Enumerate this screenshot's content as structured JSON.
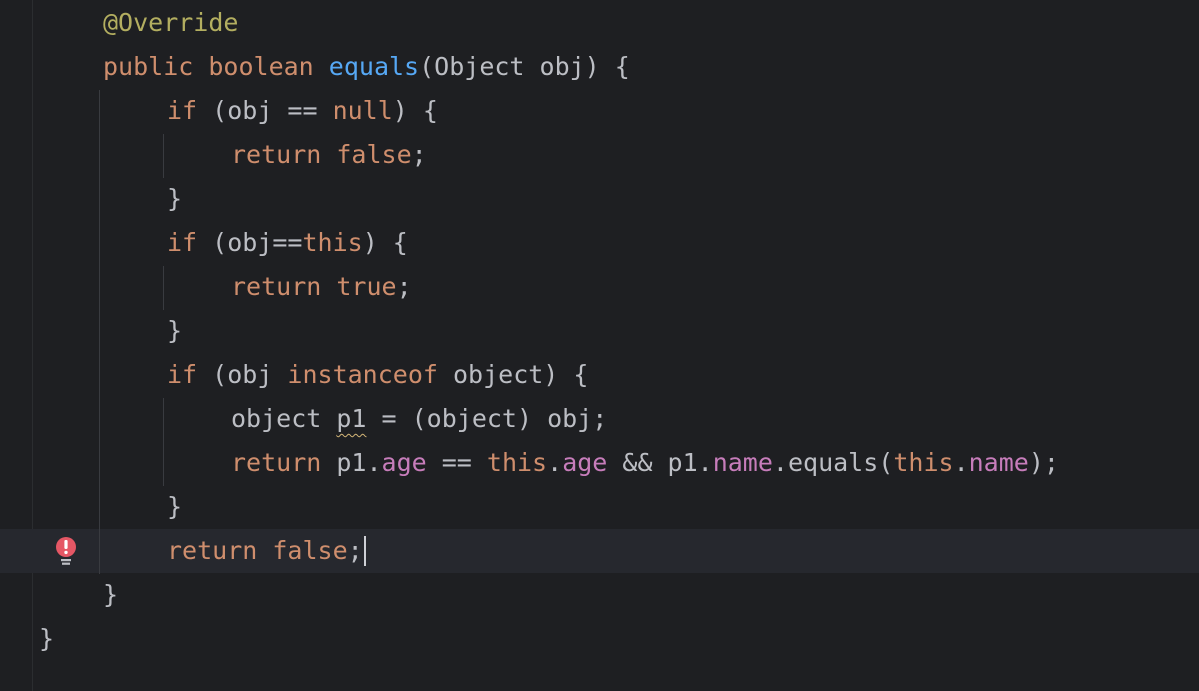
{
  "editor": {
    "language": "java",
    "colors": {
      "background": "#1e1f22",
      "current_line": "#26282e",
      "keyword": "#cf8e6d",
      "annotation": "#b3ae60",
      "method_declaration": "#56a8f5",
      "field": "#c77dbb",
      "default_text": "#bcbec4",
      "error_marker": "#e55765"
    },
    "gutter_icon": "error-lightbulb-icon",
    "lines": [
      {
        "indent": 1,
        "tokens": [
          {
            "t": "@Override",
            "c": "an"
          }
        ]
      },
      {
        "indent": 1,
        "tokens": [
          {
            "t": "public",
            "c": "kw"
          },
          {
            "t": " "
          },
          {
            "t": "boolean",
            "c": "kw"
          },
          {
            "t": " "
          },
          {
            "t": "equals",
            "c": "fn"
          },
          {
            "t": "(Object obj) {"
          }
        ]
      },
      {
        "indent": 2,
        "tokens": [
          {
            "t": "if",
            "c": "kw"
          },
          {
            "t": " (obj == "
          },
          {
            "t": "null",
            "c": "kw"
          },
          {
            "t": ") {"
          }
        ]
      },
      {
        "indent": 3,
        "tokens": [
          {
            "t": "return",
            "c": "kw"
          },
          {
            "t": " "
          },
          {
            "t": "false",
            "c": "kw"
          },
          {
            "t": ";"
          }
        ]
      },
      {
        "indent": 2,
        "tokens": [
          {
            "t": "}"
          }
        ]
      },
      {
        "indent": 2,
        "tokens": [
          {
            "t": "if",
            "c": "kw"
          },
          {
            "t": " (obj=="
          },
          {
            "t": "this",
            "c": "kw"
          },
          {
            "t": ") {"
          }
        ]
      },
      {
        "indent": 3,
        "tokens": [
          {
            "t": "return",
            "c": "kw"
          },
          {
            "t": " "
          },
          {
            "t": "true",
            "c": "kw"
          },
          {
            "t": ";"
          }
        ]
      },
      {
        "indent": 2,
        "tokens": [
          {
            "t": "}"
          }
        ]
      },
      {
        "indent": 2,
        "tokens": [
          {
            "t": "if",
            "c": "kw"
          },
          {
            "t": " (obj "
          },
          {
            "t": "instanceof",
            "c": "kw"
          },
          {
            "t": " object) {"
          }
        ]
      },
      {
        "indent": 3,
        "tokens": [
          {
            "t": "object "
          },
          {
            "t": "p1",
            "c": "tx",
            "warn": true
          },
          {
            "t": " = (object) obj;"
          }
        ]
      },
      {
        "indent": 3,
        "tokens": [
          {
            "t": "return",
            "c": "kw"
          },
          {
            "t": " p1."
          },
          {
            "t": "age",
            "c": "fd"
          },
          {
            "t": " == "
          },
          {
            "t": "this",
            "c": "kw"
          },
          {
            "t": "."
          },
          {
            "t": "age",
            "c": "fd"
          },
          {
            "t": " && p1."
          },
          {
            "t": "name",
            "c": "fd"
          },
          {
            "t": ".equals("
          },
          {
            "t": "this",
            "c": "kw"
          },
          {
            "t": "."
          },
          {
            "t": "name",
            "c": "fd"
          },
          {
            "t": ");"
          }
        ]
      },
      {
        "indent": 2,
        "tokens": [
          {
            "t": "}"
          }
        ]
      },
      {
        "indent": 2,
        "tokens": [
          {
            "t": "return",
            "c": "kw"
          },
          {
            "t": " "
          },
          {
            "t": "false",
            "c": "kw"
          },
          {
            "t": ";"
          }
        ],
        "current": true,
        "caret_after": true
      },
      {
        "indent": 1,
        "tokens": [
          {
            "t": "}"
          }
        ]
      },
      {
        "indent": 0,
        "tokens": [
          {
            "t": "}"
          }
        ]
      }
    ]
  }
}
